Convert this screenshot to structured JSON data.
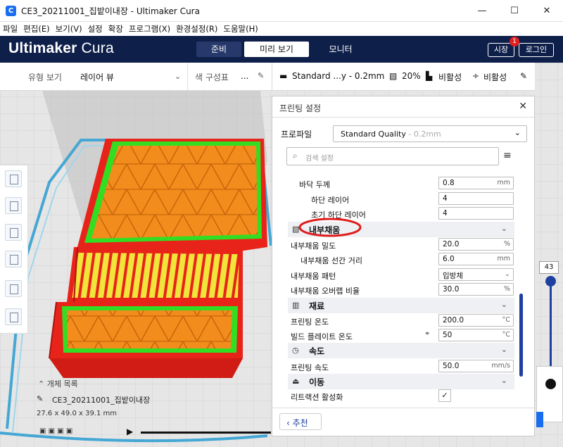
{
  "window": {
    "app_icon": "C",
    "title": "CE3_20211001_집밭이내장 - Ultimaker Cura",
    "minimize": "—",
    "maximize": "☐",
    "close": "✕"
  },
  "menu": [
    "파일",
    "편집(E)",
    "보기(V)",
    "설정",
    "확장",
    "프로그램(X)",
    "환경설정(R)",
    "도움말(H)"
  ],
  "header": {
    "brand_bold": "Ultimaker",
    "brand_light": " Cura",
    "tabs": [
      "준비",
      "미리 보기",
      "모니터"
    ],
    "selected_tab": "미리 보기",
    "market_label": "시장",
    "market_badge": "1",
    "login_label": "로그인"
  },
  "view_bar": {
    "view_type_label": "유형 보기",
    "view_type_value": "레이어 뷰",
    "color_label": "색 구성표",
    "color_value": "..."
  },
  "print_bar": {
    "profile": "Standard ...y - 0.2mm",
    "infill": "20%",
    "support": "비활성",
    "adhesion": "비활성"
  },
  "panel": {
    "title": "프린팅 설정",
    "close": "✕",
    "profile_label": "프로파일",
    "profile_value": "Standard Quality",
    "profile_dim": " - 0.2mm",
    "search_placeholder": "검색 설정",
    "menu_icon": "≡",
    "rows": {
      "bottom_thickness": {
        "label": "바닥 두께",
        "value": "0.8",
        "unit": "mm"
      },
      "bottom_layers": {
        "label": "하단 레이어",
        "value": "4"
      },
      "initial_bottom_layers": {
        "label": "초기 하단 레이어",
        "value": "4"
      },
      "infill_density": {
        "label": "내부채움 밀도",
        "value": "20.0",
        "unit": "%"
      },
      "infill_line_distance": {
        "label": "내부채움 선간 거리",
        "value": "6.0",
        "unit": "mm"
      },
      "infill_pattern": {
        "label": "내부채움 패턴",
        "value": "입방체"
      },
      "infill_overlap": {
        "label": "내부채움 오버랩 비율",
        "value": "30.0",
        "unit": "%"
      },
      "print_temp": {
        "label": "프린팅 온도",
        "value": "200.0",
        "unit": "°C"
      },
      "bed_temp": {
        "label": "빌드 플레이트 온도",
        "value": "50",
        "unit": "°C"
      },
      "print_speed": {
        "label": "프린팅 속도",
        "value": "50.0",
        "unit": "mm/s"
      },
      "retraction": {
        "label": "리트랙션 활성화",
        "checked": "✓"
      }
    },
    "categories": {
      "infill": "내부채움",
      "material": "재료",
      "speed": "속도",
      "travel": "이동"
    },
    "recommended": "‹ 추천"
  },
  "objects": {
    "list_label": "개체 목록",
    "name": "CE3_20211001_집밭이내장",
    "dims": "27.6 x 49.0 x 39.1 mm"
  },
  "layer_slider": {
    "current": "43"
  },
  "colors": {
    "header_bg": "#0e1f4a",
    "accent": "#1e3fa0",
    "model_red": "#e8231a",
    "infill_orange": "#f28c1c",
    "skin_yellow": "#f1e43a",
    "wall_green": "#33dd22"
  }
}
